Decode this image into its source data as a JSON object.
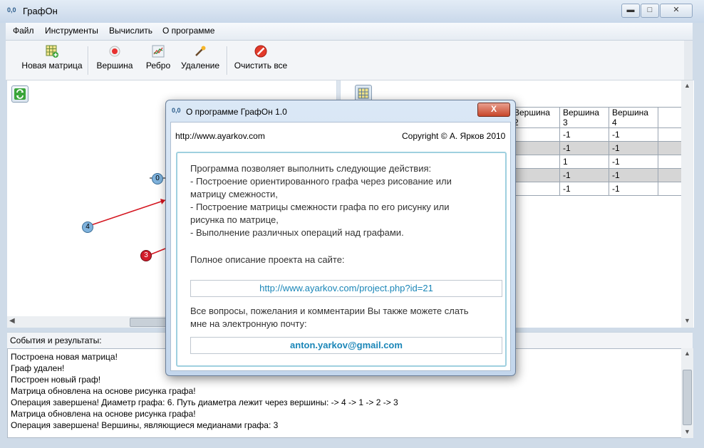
{
  "window": {
    "title": "ГрафОн",
    "app_icon": "0,0"
  },
  "menu": [
    "Файл",
    "Инструменты",
    "Вычислить",
    "О программе"
  ],
  "toolbar": {
    "new_matrix": "Новая матрица",
    "vertex": "Вершина",
    "edge": "Ребро",
    "delete": "Удаление",
    "clear_all": "Очистить все"
  },
  "graph": {
    "nodes": [
      "0",
      "4",
      "3"
    ]
  },
  "matrix": {
    "headers": [
      "Вершина 2",
      "Вершина 3",
      "Вершина 4"
    ],
    "rows": [
      [
        "",
        "-1",
        "-1"
      ],
      [
        "",
        "-1",
        "-1"
      ],
      [
        "",
        "1",
        "-1"
      ],
      [
        "",
        "-1",
        "-1"
      ],
      [
        "",
        "-1",
        "-1"
      ]
    ]
  },
  "events": {
    "header": "События и результаты:",
    "log": [
      "Построена новая матрица!",
      "Граф удален!",
      "Построен новый граф!",
      "Матрица обновлена на основе рисунка графа!",
      "Операция завершена! Диаметр графа: 6. Путь диаметра лежит через вершины: -> 4 -> 1 -> 2 -> 3",
      "Матрица обновлена на основе рисунка графа!",
      "Операция завершена! Вершины, являющиеся медианами графа: 3"
    ]
  },
  "dialog": {
    "title": "О программе ГрафОн 1.0",
    "site": "http://www.ayarkov.com",
    "copyright": "Copyright © А. Ярков 2010",
    "text_lines": [
      "Программа позволяет выполнить следующие действия:",
      "- Построение ориентированного графа через рисование или",
      "матрицу смежности,",
      "- Построение матрицы смежности графа по его рисунку или",
      "рисунка по матрице,",
      "- Выполнение различных операций над графами."
    ],
    "project_label": "Полное описание проекта на сайте:",
    "project_url": "http://www.ayarkov.com/project.php?id=21",
    "contact_lines": [
      "Все вопросы, пожелания и комментарии Вы также можете слать",
      "мне на электронную почту:"
    ],
    "email": "anton.yarkov@gmail.com",
    "close_glyph": "X"
  },
  "colors": {
    "link": "#1a86b8",
    "node_blue": "#7fb2dc",
    "node_red": "#d21c2a",
    "edge": "#d4141e"
  }
}
